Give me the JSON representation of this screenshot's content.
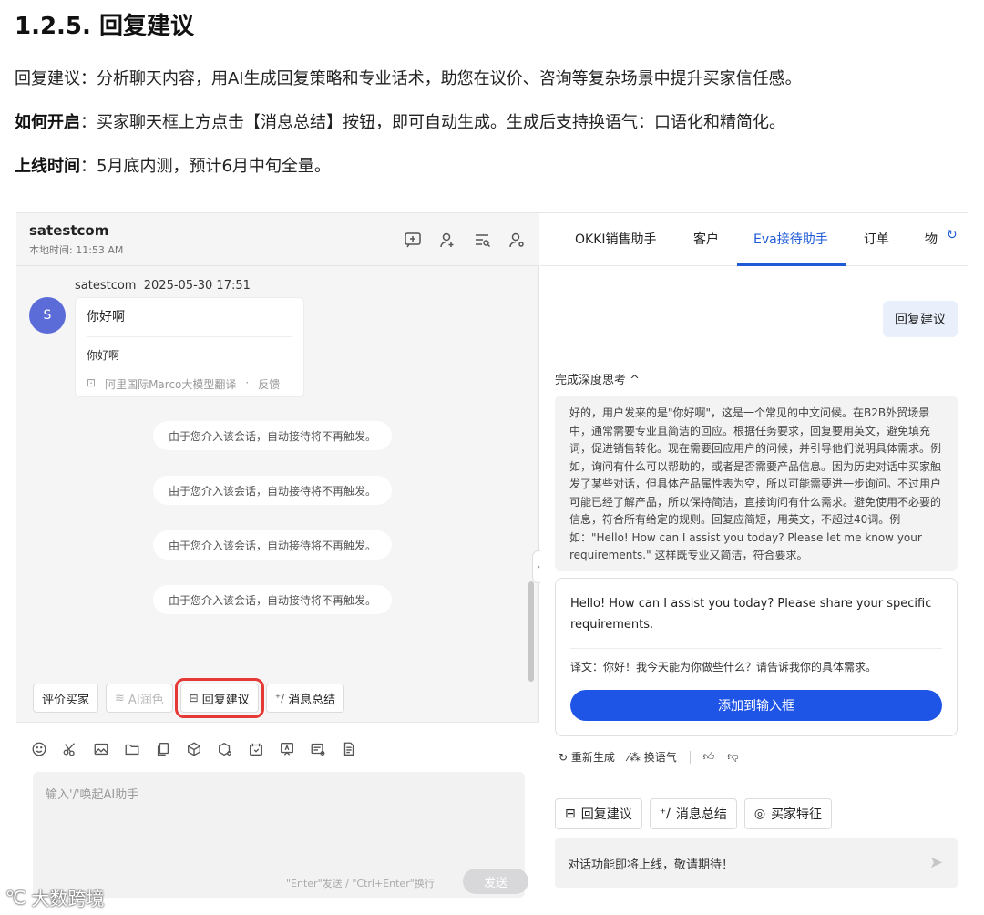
{
  "doc": {
    "title": "1.2.5. 回复建议",
    "line1": "回复建议：分析聊天内容，用AI生成回复策略和专业话术，助您在议价、咨询等复杂场景中提升买家信任感。",
    "line2_label": "如何开启",
    "line2_text": "：买家聊天框上方点击【消息总结】按钮，即可自动生成。生成后支持换语气：口语化和精简化。",
    "line3_label": "上线时间",
    "line3_text": "：5月底内测，预计6月中旬全量。"
  },
  "chat": {
    "contact_name": "satestcom",
    "local_time": "本地时间: 11:53 AM",
    "header_icons": [
      "add-message-icon",
      "add-contact-icon",
      "search-list-icon",
      "user-settings-icon"
    ],
    "message": {
      "sender": "satestcom",
      "timestamp": "2025-05-30 17:51",
      "avatar_letter": "S",
      "text": "你好啊",
      "translation": "你好啊",
      "translator": "阿里国际Marco大模型翻译",
      "feedback": "反馈"
    },
    "system_notices": [
      "由于您介入该会话，自动接待将不再触发。",
      "由于您介入该会话，自动接待将不再触发。",
      "由于您介入该会话，自动接待将不再触发。",
      "由于您介入该会话，自动接待将不再触发。"
    ],
    "actions": {
      "rate_buyer": "评价买家",
      "ai_polish": "AI润色",
      "reply_suggest": "回复建议",
      "summary": "消息总结"
    },
    "input": {
      "placeholder": "输入'/'唤起AI助手",
      "hint": "\"Enter\"发送 / \"Ctrl+Enter\"换行",
      "send": "发送"
    }
  },
  "assistant": {
    "tabs": [
      "OKKI销售助手",
      "客户",
      "Eva接待助手",
      "订单",
      "物"
    ],
    "active_tab": "Eva接待助手",
    "reply_chip": "回复建议",
    "thinking_label": "完成深度思考",
    "thinking_text": "好的，用户发来的是\"你好啊\"，这是一个常见的中文问候。在B2B外贸场景中，通常需要专业且简洁的回应。根据任务要求，回复要用英文，避免填充词，促进销售转化。现在需要回应用户的问候，并引导他们说明具体需求。例如，询问有什么可以帮助的，或者是否需要产品信息。因为历史对话中买家触发了某些对话，但具体产品属性表为空，所以可能需要进一步询问。不过用户可能已经了解产品，所以保持简洁，直接询问有什么需求。避免使用不必要的信息，符合所有给定的规则。回复应简短，用英文，不超过40词。例如：\"Hello! How can I assist you today? Please let me know your requirements.\" 这样既专业又简洁，符合要求。",
    "answer_en": "Hello! How can I assist you today? Please share your specific requirements.",
    "answer_translation": "译文：你好！我今天能为你做些什么？请告诉我你的具体需求。",
    "add_to_input": "添加到输入框",
    "regenerate": "重新生成",
    "change_tone": "换语气",
    "bottom_actions": {
      "reply_suggest": "回复建议",
      "summary": "消息总结",
      "buyer_profile": "买家特征"
    },
    "input_placeholder": "对话功能即将上线，敬请期待！"
  },
  "watermark": "大数跨境",
  "colors": {
    "accent": "#1f55e6",
    "highlight": "#e53935",
    "avatar": "#5b6bd8"
  }
}
